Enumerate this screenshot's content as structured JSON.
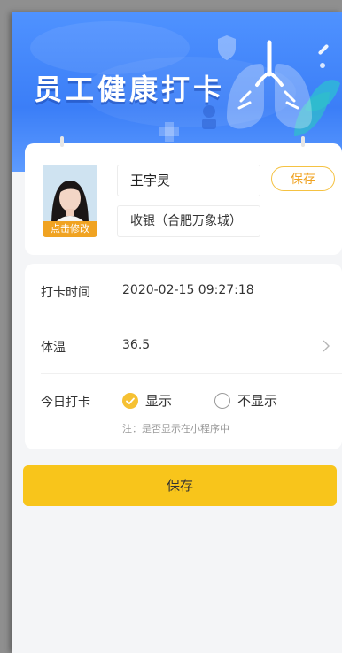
{
  "header": {
    "title": "员工健康打卡"
  },
  "profile": {
    "avatar_badge": "点击修改",
    "name": "王宇灵",
    "department": "收银（合肥万象城）",
    "save_label": "保存"
  },
  "form": {
    "checkin_time": {
      "label": "打卡时间",
      "value": "2020-02-15 09:27:18"
    },
    "temperature": {
      "label": "体温",
      "value": "36.5"
    },
    "today_checkin": {
      "label": "今日打卡",
      "options": [
        {
          "label": "显示",
          "selected": true
        },
        {
          "label": "不显示",
          "selected": false
        }
      ],
      "note": "注：是否显示在小程序中"
    }
  },
  "footer": {
    "save_label": "保存"
  },
  "colors": {
    "header_blue": "#3b7ef7",
    "accent_yellow": "#f8c51b",
    "badge_orange": "#f0a322"
  }
}
